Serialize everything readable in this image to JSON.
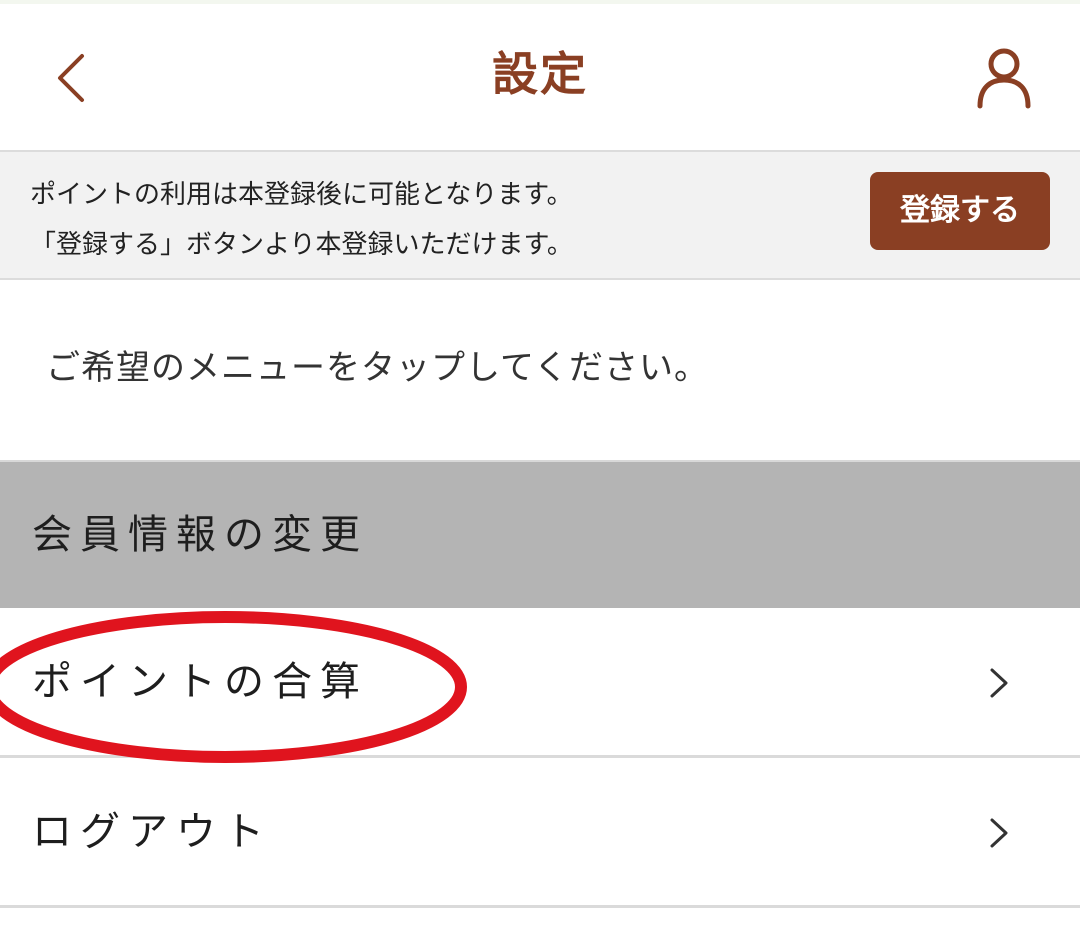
{
  "header": {
    "title": "設定",
    "back_icon": "chevron-left-icon",
    "account_icon": "person-icon",
    "accent_color": "#8a3f23"
  },
  "notice": {
    "line1": "ポイントの利用は本登録後に可能となります。",
    "line2": "「登録する」ボタンより本登録いただけます。",
    "register_button": "登録する"
  },
  "instruction": "ご希望のメニューをタップしてください。",
  "section": {
    "title": "会員情報の変更"
  },
  "menu": {
    "items": [
      {
        "label": "ポイントの合算",
        "icon": "chevron-right-icon",
        "highlighted": true
      },
      {
        "label": "ログアウト",
        "icon": "chevron-right-icon",
        "highlighted": false
      }
    ]
  },
  "annotation": {
    "shape": "ellipse",
    "color": "#e0141e"
  }
}
